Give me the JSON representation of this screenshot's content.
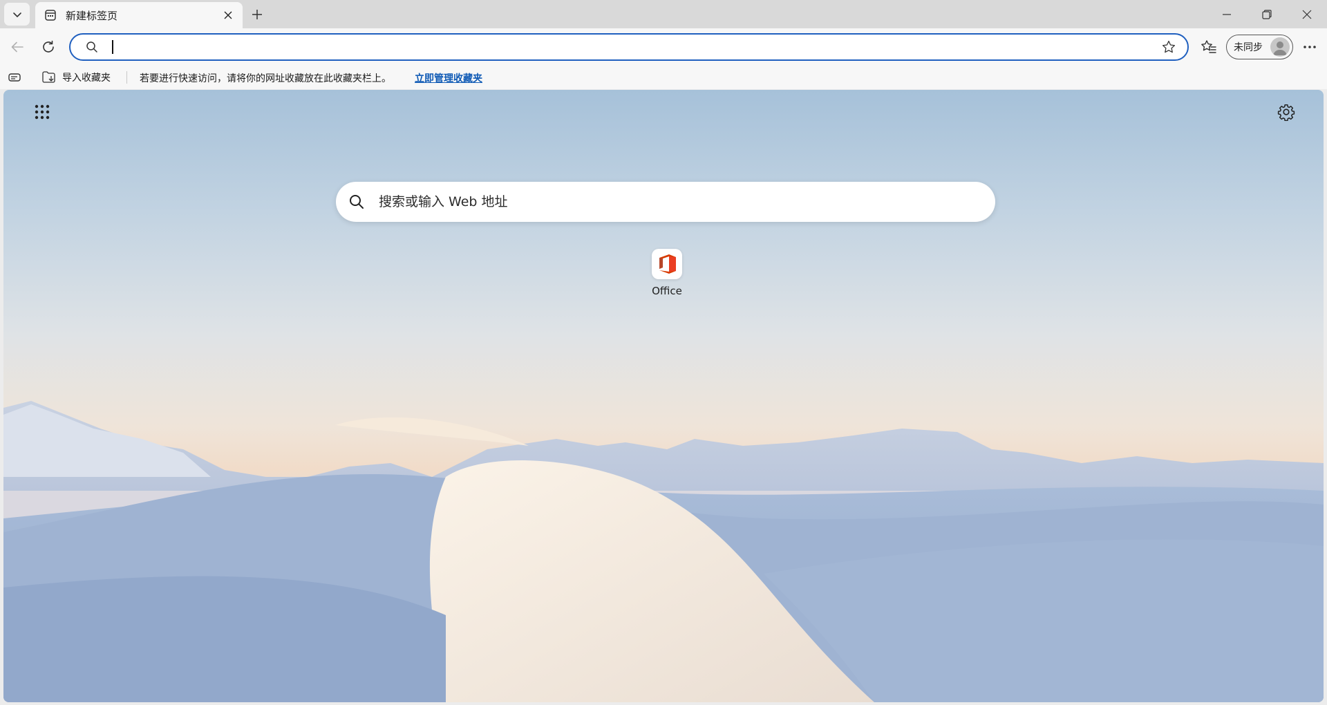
{
  "tabs": [
    {
      "title": "新建标签页"
    }
  ],
  "toolbar": {
    "address_value": "",
    "profile_label": "未同步"
  },
  "favorites_bar": {
    "import_label": "导入收藏夹",
    "message": "若要进行快速访问，请将你的网址收藏放在此收藏夹栏上。",
    "manage_link": "立即管理收藏夹"
  },
  "ntp": {
    "search_placeholder": "搜索或输入 Web 地址",
    "quick_links": [
      {
        "label": "Office",
        "icon": "office-icon"
      }
    ]
  },
  "colors": {
    "accent": "#1f5fbf",
    "link": "#0f5ab5",
    "office_red": "#d83b01"
  }
}
